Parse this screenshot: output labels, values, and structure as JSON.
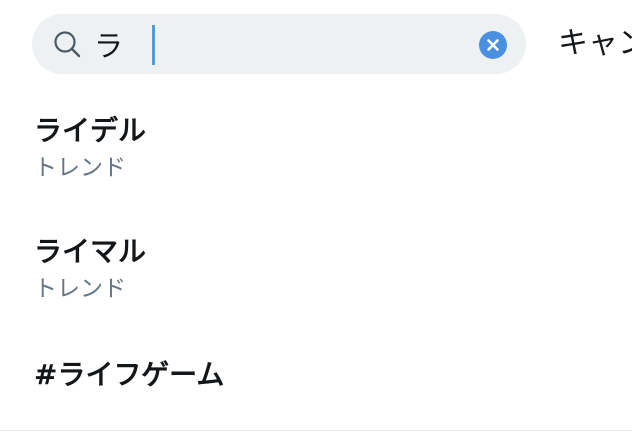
{
  "search": {
    "query": "ラ",
    "cancel_label": "キャンセル"
  },
  "suggestions": [
    {
      "title": "ライデル",
      "subtitle": "トレンド"
    },
    {
      "title": "ライマル",
      "subtitle": "トレンド"
    },
    {
      "title": "#ライフゲーム"
    }
  ],
  "colors": {
    "search_bg": "#edf1f1",
    "accent": "#4a90e2",
    "primary_text": "#14171a",
    "secondary_text": "#657786"
  },
  "icons": {
    "search": "search-icon",
    "clear": "close-icon"
  }
}
